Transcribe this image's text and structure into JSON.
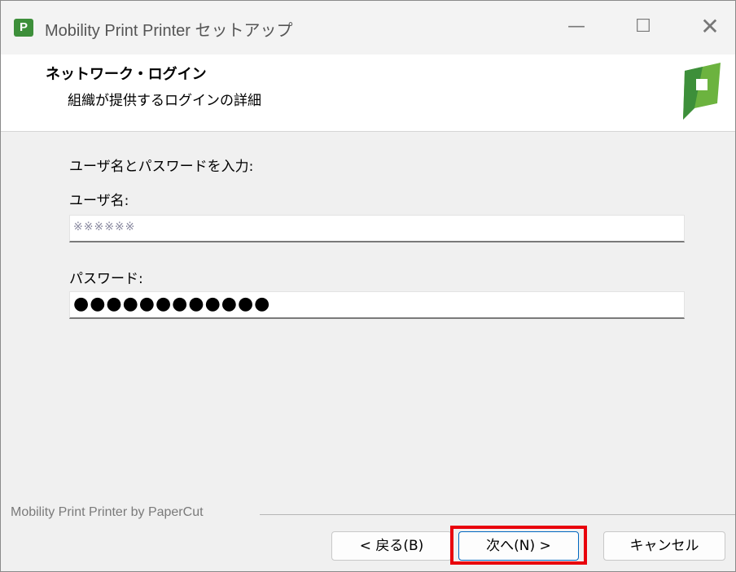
{
  "window": {
    "title": "Mobility Print Printer セットアップ",
    "icon_letter": "P"
  },
  "titlebar": {
    "minimize_glyph": "—",
    "maximize_glyph": "☐",
    "close_glyph": "✕"
  },
  "header": {
    "title": "ネットワーク・ログイン",
    "subtitle": "組織が提供するログインの詳細"
  },
  "form": {
    "instruction": "ユーザ名とパスワードを入力:",
    "username_label": "ユーザ名:",
    "username_value": "※※※※※※",
    "password_label": "パスワード:",
    "password_value": "●●●●●●●●●●●●"
  },
  "footer": {
    "branding": "Mobility Print Printer by PaperCut"
  },
  "buttons": {
    "back": "< 戻る(B)",
    "next": "次へ(N) >",
    "cancel": "キャンセル"
  },
  "colors": {
    "accent": "#0067c0",
    "highlight": "#e8000c",
    "logo_green": "#3d8f3a"
  }
}
